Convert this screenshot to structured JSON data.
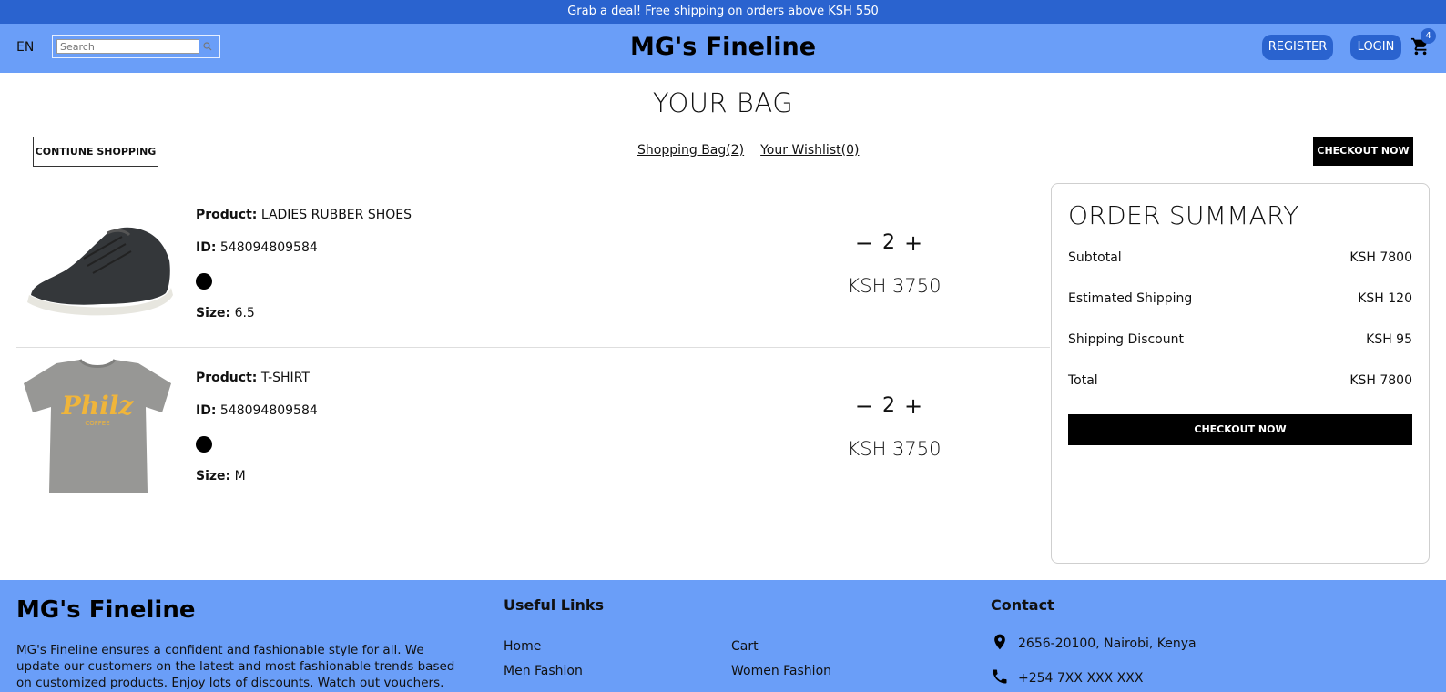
{
  "announcement": "Grab a deal! Free shipping on orders above KSH 550",
  "header": {
    "language": "EN",
    "search_placeholder": "Search",
    "brand": "MG's Fineline",
    "register_label": "REGISTER",
    "login_label": "LOGIN",
    "cart_count": "4"
  },
  "page": {
    "title": "YOUR BAG",
    "continue_label": "CONTIUNE SHOPPING",
    "shopping_bag_link": "Shopping Bag(2)",
    "wishlist_link": "Your Wishlist(0)",
    "checkout_label": "CHECKOUT NOW"
  },
  "labels": {
    "product": "Product:",
    "id": "ID:",
    "size": "Size:"
  },
  "products": [
    {
      "name": "LADIES RUBBER SHOES",
      "id": "548094809584",
      "color": "#000000",
      "size": "6.5",
      "quantity": "2",
      "price": "KSH 3750",
      "image": "shoe-image"
    },
    {
      "name": "T-SHIRT",
      "id": "548094809584",
      "color": "#000000",
      "size": "M",
      "quantity": "2",
      "price": "KSH 3750",
      "image": "tshirt-image"
    }
  ],
  "summary": {
    "title": "ORDER SUMMARY",
    "rows": [
      {
        "label": "Subtotal",
        "value": "KSH 7800"
      },
      {
        "label": "Estimated Shipping",
        "value": "KSH 120"
      },
      {
        "label": "Shipping Discount",
        "value": "KSH 95"
      },
      {
        "label": "Total",
        "value": "KSH 7800"
      }
    ],
    "checkout_label": "CHECKOUT NOW"
  },
  "footer": {
    "brand": "MG's Fineline",
    "description": "MG's Fineline ensures a confident and fashionable style for all. We update our customers on the latest and most fashionable trends based on customized products. Enjoy lots of discounts. Watch out vouchers.",
    "useful_title": "Useful Links",
    "links": [
      "Home",
      "Cart",
      "Men Fashion",
      "Women Fashion"
    ],
    "contact_title": "Contact",
    "address": "2656-20100, Nairobi, Kenya",
    "phone": "+254 7XX XXX XXX"
  },
  "colors": {
    "announcement_bg": "#2a63cf",
    "navbar_bg": "#6a9ef8",
    "accent": "#2a63cf",
    "checkout_bg": "#000000"
  }
}
